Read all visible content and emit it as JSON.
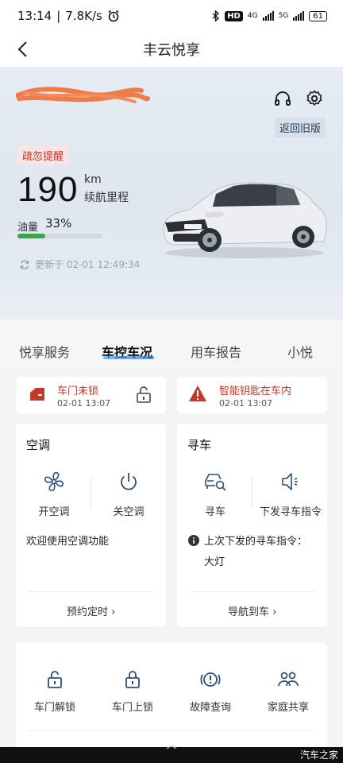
{
  "status_bar": {
    "time": "13:14",
    "speed": "7.8K/s",
    "network_4g": "4G",
    "network_5g": "5G",
    "hd": "HD",
    "battery": "61"
  },
  "nav": {
    "title": "丰云悦享"
  },
  "hero": {
    "old_version": "返回旧版",
    "reminder": "疏忽提醒",
    "range_value": "190",
    "range_unit": "km",
    "range_label": "续航里程",
    "fuel_label": "油量",
    "fuel_value": "33%",
    "fuel_fraction": 0.33,
    "updated": "更新于 02-01 12:49:34"
  },
  "tabs": [
    {
      "label": "悦享服务"
    },
    {
      "label": "车控车况",
      "active": true
    },
    {
      "label": "用车报告"
    },
    {
      "label": "小悦"
    }
  ],
  "alerts": [
    {
      "title": "车门未锁",
      "time": "02-01 13:07"
    },
    {
      "title": "智能钥匙在车内",
      "time": "02-01 13:07"
    }
  ],
  "ac_card": {
    "title": "空调",
    "on_label": "开空调",
    "off_label": "关空调",
    "welcome": "欢迎使用空调功能",
    "link": "预约定时 ›"
  },
  "find_card": {
    "title": "寻车",
    "find_label": "寻车",
    "send_label": "下发寻车指令",
    "last_cmd": "上次下发的寻车指令：",
    "last_cmd_value": "大灯",
    "link": "导航到车 ›"
  },
  "bottom_actions": [
    {
      "label": "车门解锁",
      "icon": "unlock-icon"
    },
    {
      "label": "车门上锁",
      "icon": "lock-icon"
    },
    {
      "label": "故障查询",
      "icon": "fault-icon"
    },
    {
      "label": "家庭共享",
      "icon": "family-icon"
    }
  ],
  "watermark": "汽车之家",
  "colors": {
    "alert_red": "#c0392b",
    "fuel_green": "#3aa44a",
    "icon_blue": "#2c4f7c",
    "tab_accent": "#2c6fd6"
  }
}
